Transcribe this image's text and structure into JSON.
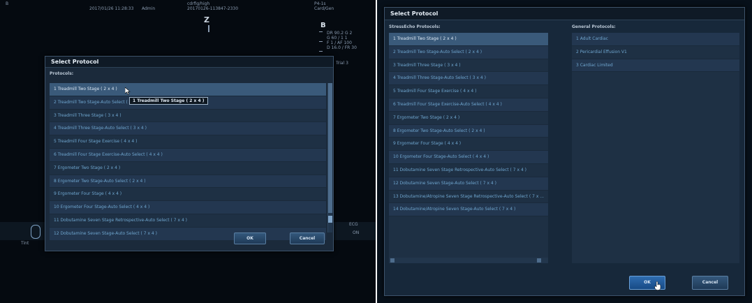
{
  "left": {
    "header": {
      "mark": "B",
      "date_time": "2017/01/26 11:28:33",
      "user": "Admin",
      "device": "cdrfig/high",
      "id": "20170126-113847-2330",
      "probe": "P4-1s",
      "preset": "Card/Gen",
      "mode": "B",
      "params": [
        "DR 90.2 G 2",
        "G 60 / 1 1",
        "F 1 / AF 100",
        "D 16.0 / FR 30",
        "Trial 3"
      ],
      "z": "Z"
    },
    "dialog": {
      "title": "Select Protocol",
      "section": "Protocols:",
      "items": [
        "1 Treadmill Two Stage ( 2 x 4 )",
        "2 Treadmill Two Stage-Auto Select ( 2 x 4 )",
        "3 Treadmill Three Stage ( 3 x 4 )",
        "4 Treadmill Three Stage-Auto Select ( 3 x 4 )",
        "5 Treadmill Four Stage Exercise ( 4 x 4 )",
        "6 Treadmill Four Stage Exercise-Auto Select ( 4 x 4 )",
        "7 Ergometer Two Stage ( 2 x 4 )",
        "8 Ergometer Two Stage-Auto Select ( 2 x 4 )",
        "9 Ergometer Four Stage ( 4 x 4 )",
        "10 Ergometer Four Stage-Auto Select ( 4 x 4 )",
        "11 Dobutamine Seven Stage Retrospective-Auto Select ( 7 x 4 )",
        "12 Dobutamine Seven Stage-Auto Select ( 7 x 4 )"
      ],
      "tooltip": "1 Treadmill Two Stage ( 2 x 4 )",
      "ok_label": "OK",
      "cancel_label": "Cancel"
    },
    "side_labels": [
      "ECG",
      "ON",
      "Tint"
    ]
  },
  "right": {
    "dialog": {
      "title": "Select Protocol",
      "section_stress": "StressEcho Protocols:",
      "section_general": "General Protocols:",
      "stress_items": [
        "1 Treadmill Two Stage ( 2 x 4 )",
        "2 Treadmill Two Stage-Auto Select ( 2 x 4 )",
        "3 Treadmill Three Stage ( 3 x 4 )",
        "4 Treadmill Three Stage-Auto Select ( 3 x 4 )",
        "5 Treadmill Four Stage Exercise ( 4 x 4 )",
        "6 Treadmill Four Stage Exercise-Auto Select ( 4 x 4 )",
        "7 Ergometer Two Stage ( 2 x 4 )",
        "8 Ergometer Two Stage-Auto Select ( 2 x 4 )",
        "9 Ergometer Four Stage ( 4 x 4 )",
        "10 Ergometer Four Stage-Auto Select ( 4 x 4 )",
        "11 Dobutamine Seven Stage Retrospective-Auto Select ( 7 x 4 )",
        "12 Dobutamine Seven Stage-Auto Select ( 7 x 4 )",
        "13 Dobutamine/Atropine Seven Stage Retrospective-Auto Select ( 7 x ...",
        "14 Dobutamine/Atropine Seven Stage-Auto Select ( 7 x 4 )"
      ],
      "general_items": [
        "1 Adult Cardiac",
        "2 Pericardial Effusion V1",
        "3 Cardiac Limited"
      ],
      "ok_label": "OK",
      "cancel_label": "Cancel"
    }
  }
}
